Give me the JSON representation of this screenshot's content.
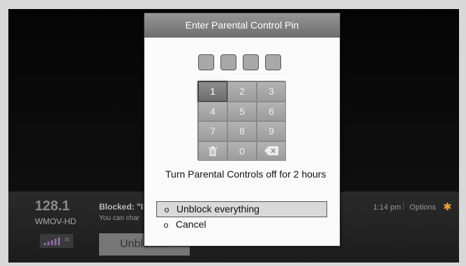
{
  "channel": {
    "number": "128.1",
    "name": "WMOV-HD",
    "blocked_text": "Blocked: \"I",
    "sub_text": "You can char",
    "unblock_button": "Unblock..."
  },
  "status": {
    "time": "1:14 pm",
    "separator": "|",
    "options_label": "Options",
    "star_icon": "✱"
  },
  "dialog": {
    "title": "Enter Parental Control Pin",
    "keys": [
      "1",
      "2",
      "3",
      "4",
      "5",
      "6",
      "7",
      "8",
      "9",
      "",
      "0",
      ""
    ],
    "prompt": "Turn Parental Controls off for 2 hours",
    "menu": [
      {
        "label": "Unblock everything",
        "bullet": "o",
        "selected": true
      },
      {
        "label": "Cancel",
        "bullet": "o",
        "selected": false
      }
    ]
  },
  "colors": {
    "accent_star": "#e8a23a",
    "dialog_header": "#808080"
  }
}
